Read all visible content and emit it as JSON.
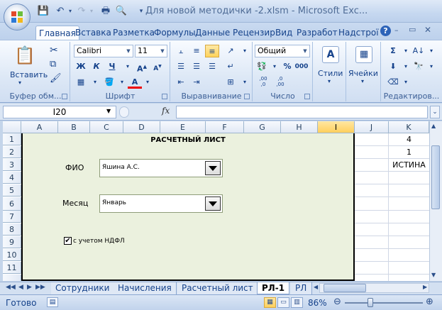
{
  "window": {
    "title": "Для новой методички -2.xlsm - Microsoft Exc..."
  },
  "ribbon_tabs": [
    "Главная",
    "Вставка",
    "Разметка",
    "Формулы",
    "Данные",
    "Рецензир",
    "Вид",
    "Разработ",
    "Надстрої"
  ],
  "groups": {
    "clipboard": {
      "label": "Буфер обм...",
      "paste": "Вставить"
    },
    "font": {
      "label": "Шрифт",
      "font_name": "Calibri",
      "font_size": "11",
      "bold": "Ж",
      "italic": "К",
      "underline": "Ч"
    },
    "alignment": {
      "label": "Выравнивание"
    },
    "number": {
      "label": "Число",
      "format": "Общий",
      "percent": "%",
      "thousands": "000",
      "inc_dec": ",00\n,0",
      "dec_dec": ",0\n,00"
    },
    "styles": {
      "label": "Стили",
      "button": "Стили"
    },
    "cells": {
      "label": "Ячейки",
      "button": "Ячейки"
    },
    "editing": {
      "label": "Редактиров..."
    }
  },
  "formula_bar": {
    "cell_ref": "I20",
    "fx": "fx",
    "formula": ""
  },
  "columns": [
    "A",
    "B",
    "C",
    "D",
    "E",
    "F",
    "G",
    "H",
    "I",
    "J",
    "K"
  ],
  "rows": [
    "1",
    "2",
    "3",
    "4",
    "5",
    "6",
    "7",
    "8",
    "9",
    "10",
    "11"
  ],
  "form": {
    "title": "РАСЧЕТНЫЙ ЛИСТ",
    "fio_label": "ФИО",
    "fio_value": "Яшина А.С.",
    "month_label": "Месяц",
    "month_value": "Январь",
    "ndfl_label": "с учетом НДФЛ",
    "ndfl_checked": "✔"
  },
  "cells_k": {
    "k1": "4",
    "k2": "1",
    "k3": "ИСТИНА"
  },
  "sheets": [
    "Сотрудники",
    "Начисления",
    "Расчетный лист",
    "РЛ-1",
    "РЛ"
  ],
  "status": {
    "text": "Готово",
    "zoom": "86%"
  }
}
